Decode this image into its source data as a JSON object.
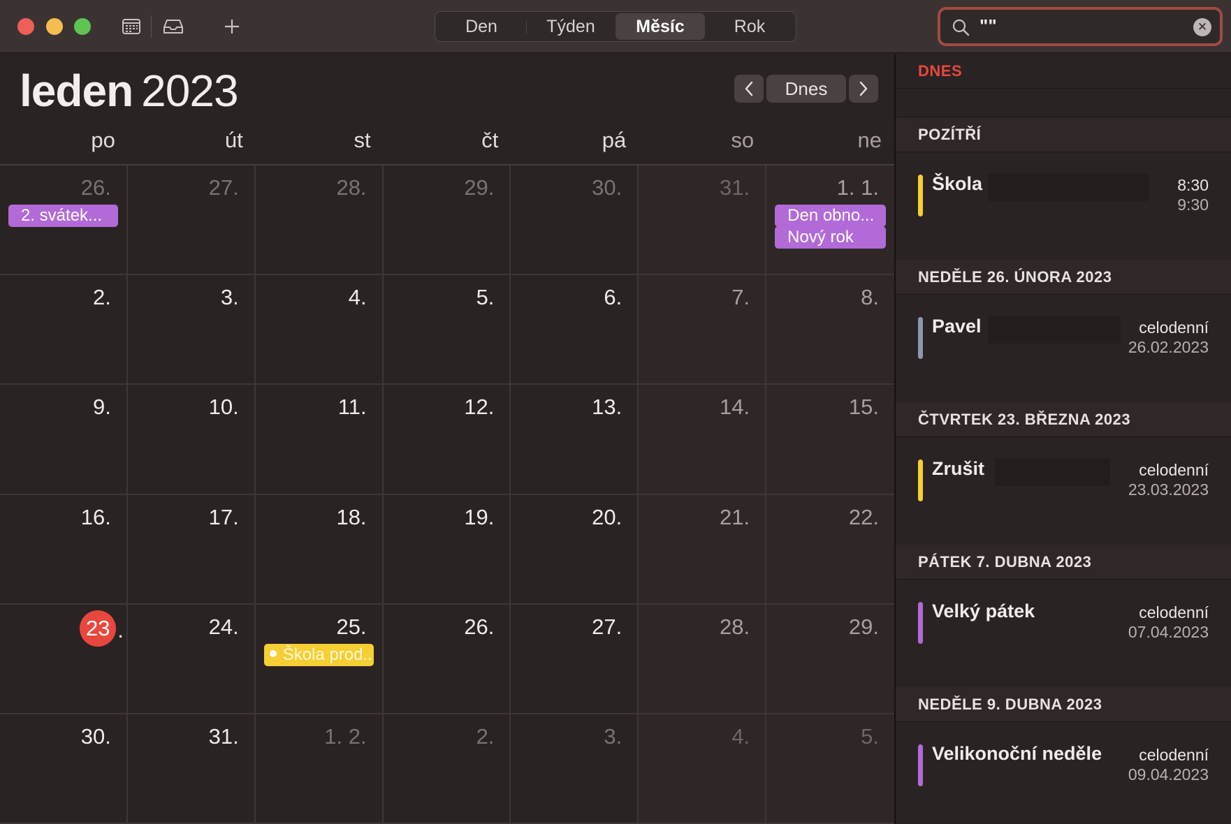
{
  "toolbar": {
    "view_tabs": [
      {
        "label": "Den",
        "active": false
      },
      {
        "label": "Týden",
        "active": false
      },
      {
        "label": "Měsíc",
        "active": true
      },
      {
        "label": "Rok",
        "active": false
      }
    ],
    "search_value": "\"\""
  },
  "calendar": {
    "month": "leden",
    "year": "2023",
    "today_button": "Dnes",
    "weekdays": [
      "po",
      "út",
      "st",
      "čt",
      "pá",
      "so",
      "ne"
    ],
    "weeks": [
      [
        "26.",
        "27.",
        "28.",
        "29.",
        "30.",
        "31.",
        "1. 1."
      ],
      [
        "2.",
        "3.",
        "4.",
        "5.",
        "6.",
        "7.",
        "8."
      ],
      [
        "9.",
        "10.",
        "11.",
        "12.",
        "13.",
        "14.",
        "15."
      ],
      [
        "16.",
        "17.",
        "18.",
        "19.",
        "20.",
        "21.",
        "22."
      ],
      [
        "23",
        "24.",
        "25.",
        "26.",
        "27.",
        "28.",
        "29."
      ],
      [
        "30.",
        "31.",
        "1. 2.",
        "2.",
        "3.",
        "4.",
        "5."
      ]
    ],
    "today_dot": ".",
    "events": {
      "w0d0": [
        "2. svátek..."
      ],
      "w0d6": [
        "Den obno...",
        "Nový rok"
      ],
      "w4d2": [
        "Škola prod..."
      ]
    }
  },
  "sidebar": {
    "today_header": "DNES",
    "sections": [
      {
        "header": "POZÍTŘÍ",
        "title": "Škola",
        "line1": "8:30",
        "line2": "9:30",
        "color": "#f5cf33"
      },
      {
        "header": "NEDĚLE 26. ÚNORA 2023",
        "title": "Pavel",
        "line1": "celodenní",
        "line2": "26.02.2023",
        "color": "#8e97b0"
      },
      {
        "header": "ČTVRTEK 23. BŘEZNA 2023",
        "title": "Zrušit",
        "line1": "celodenní",
        "line2": "23.03.2023",
        "color": "#f5cf33"
      },
      {
        "header": "PÁTEK 7. DUBNA 2023",
        "title": "Velký pátek",
        "line1": "celodenní",
        "line2": "07.04.2023",
        "color": "#b16ad8"
      },
      {
        "header": "NEDĚLE 9. DUBNA 2023",
        "title": "Velikonoční neděle",
        "line1": "celodenní",
        "line2": "09.04.2023",
        "color": "#b16ad8"
      }
    ]
  },
  "colors": {
    "accent_red": "#e8473d",
    "event_purple": "#b16ad8",
    "event_yellow": "#f5cf33"
  }
}
